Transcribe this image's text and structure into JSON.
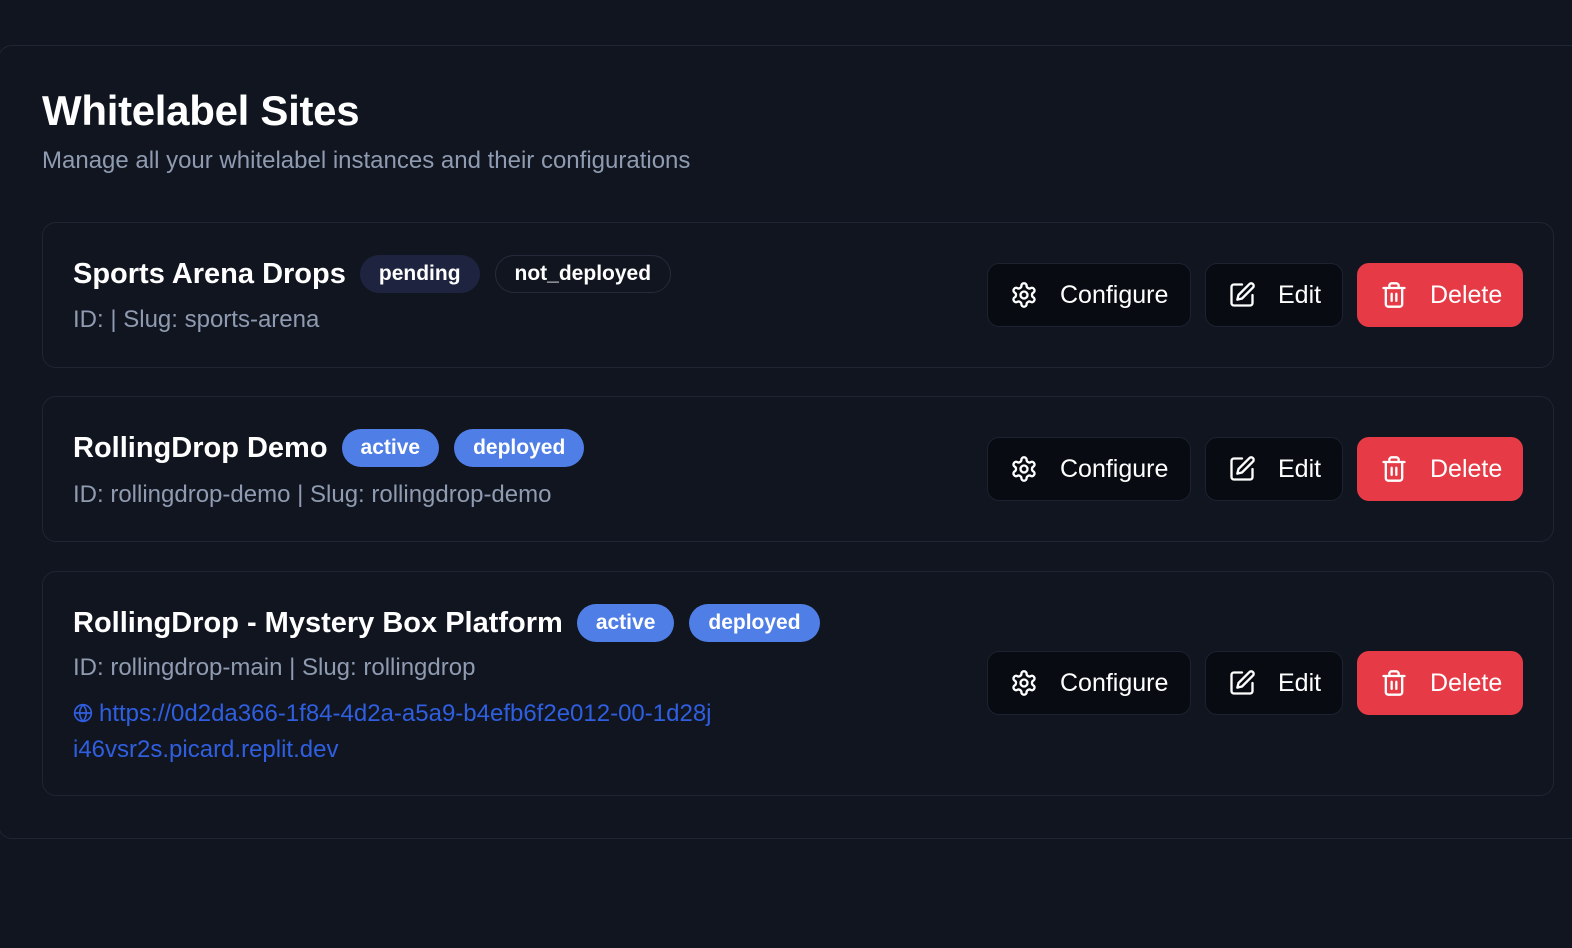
{
  "header": {
    "title": "Whitelabel Sites",
    "subtitle": "Manage all your whitelabel instances and their configurations"
  },
  "actions": {
    "configure_label": "Configure",
    "edit_label": "Edit",
    "delete_label": "Delete"
  },
  "colors": {
    "background": "#111520",
    "delete": "#e63b46",
    "badge_blue": "#4f7fe6",
    "link": "#2f5fe0"
  },
  "icons": {
    "configure": "gear-icon",
    "edit": "edit-icon",
    "delete": "trash-icon",
    "url": "globe-icon"
  },
  "sites": [
    {
      "name": "Sports Arena Drops",
      "status": "pending",
      "deployment": "not_deployed",
      "ids": "ID:  | Slug: sports-arena"
    },
    {
      "name": "RollingDrop Demo",
      "status": "active",
      "deployment": "deployed",
      "ids": "ID: rollingdrop-demo | Slug: rollingdrop-demo"
    },
    {
      "name": "RollingDrop - Mystery Box Platform",
      "status": "active",
      "deployment": "deployed",
      "ids": "ID: rollingdrop-main | Slug: rollingdrop",
      "url": "https://0d2da366-1f84-4d2a-a5a9-b4efb6f2e012-00-1d28ji46vsr2s.picard.replit.dev"
    }
  ]
}
